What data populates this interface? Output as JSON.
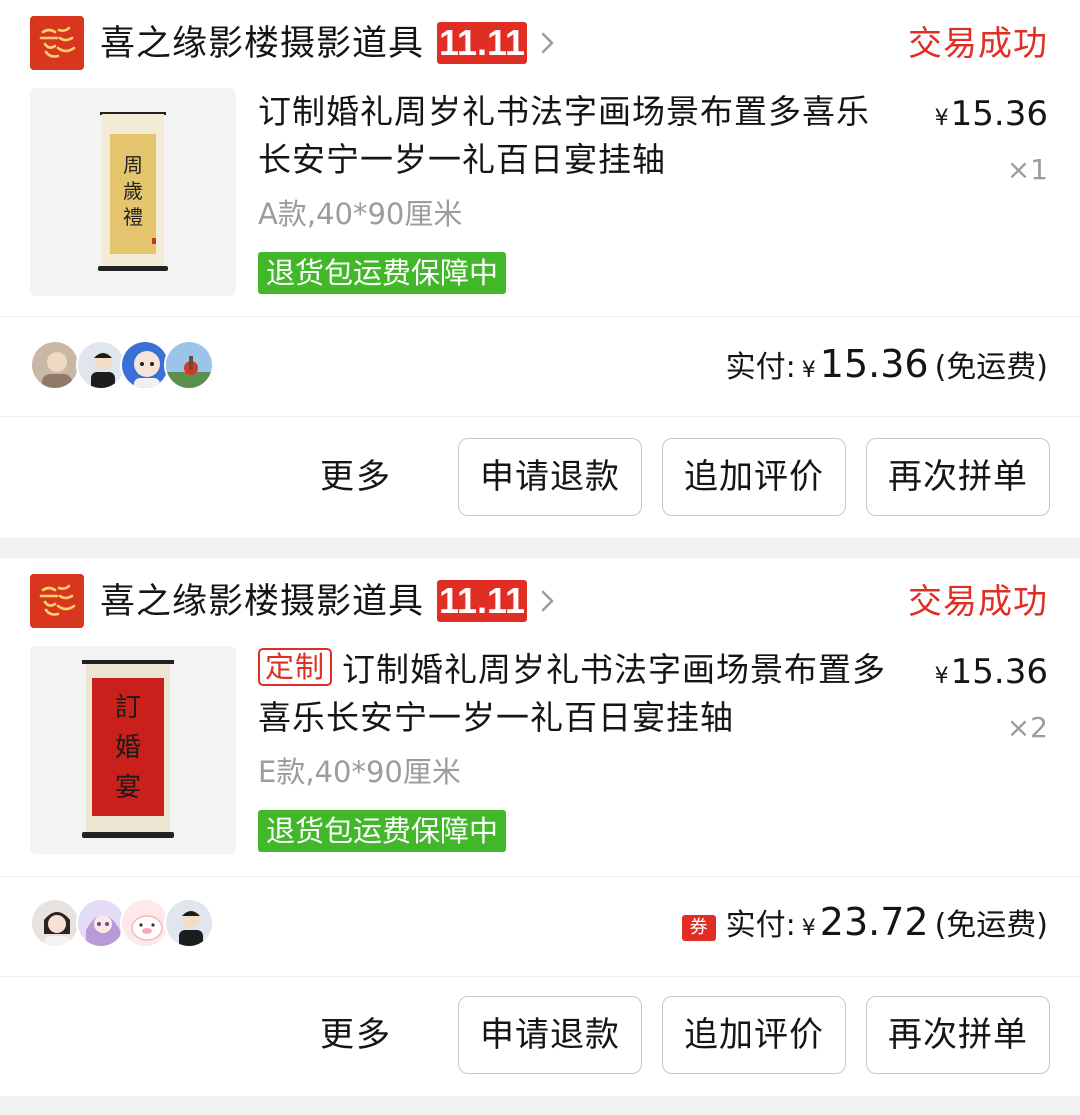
{
  "orders": [
    {
      "shop_name": "喜之缘影楼摄影道具",
      "promo_badge": "11.11",
      "status": "交易成功",
      "custom_tag": "",
      "title": "订制婚礼周岁礼书法字画场景布置多喜乐长安宁一岁一礼百日宴挂轴",
      "price_symbol": "¥",
      "price": "15.36",
      "quantity": "×1",
      "spec": "A款,40*90厘米",
      "guarantee": "退货包运费保障中",
      "thumb_icon": "scroll-painting-beige",
      "coupon_icon": "",
      "paid_label": "实付:",
      "paid_symbol": "¥",
      "paid_amount": "15.36",
      "paid_note": "(免运费)",
      "avatars": [
        "buyer-avatar-1",
        "buyer-avatar-2",
        "buyer-avatar-3",
        "buyer-avatar-4"
      ],
      "actions": {
        "more": "更多",
        "refund": "申请退款",
        "review": "追加评价",
        "reorder": "再次拼单"
      }
    },
    {
      "shop_name": "喜之缘影楼摄影道具",
      "promo_badge": "11.11",
      "status": "交易成功",
      "custom_tag": "定制",
      "title": "订制婚礼周岁礼书法字画场景布置多喜乐长安宁一岁一礼百日宴挂轴",
      "price_symbol": "¥",
      "price": "15.36",
      "quantity": "×2",
      "spec": "E款,40*90厘米",
      "guarantee": "退货包运费保障中",
      "thumb_icon": "scroll-painting-red",
      "coupon_icon": "券",
      "paid_label": "实付:",
      "paid_symbol": "¥",
      "paid_amount": "23.72",
      "paid_note": "(免运费)",
      "avatars": [
        "buyer-avatar-1",
        "buyer-avatar-2",
        "buyer-avatar-3",
        "buyer-avatar-4"
      ],
      "actions": {
        "more": "更多",
        "refund": "申请退款",
        "review": "追加评价",
        "reorder": "再次拼单"
      }
    }
  ],
  "colors": {
    "accent_red": "#e02e24",
    "guarantee_green": "#42b72a",
    "muted_text": "#9c9c9c",
    "logo_red": "#d8361f"
  }
}
